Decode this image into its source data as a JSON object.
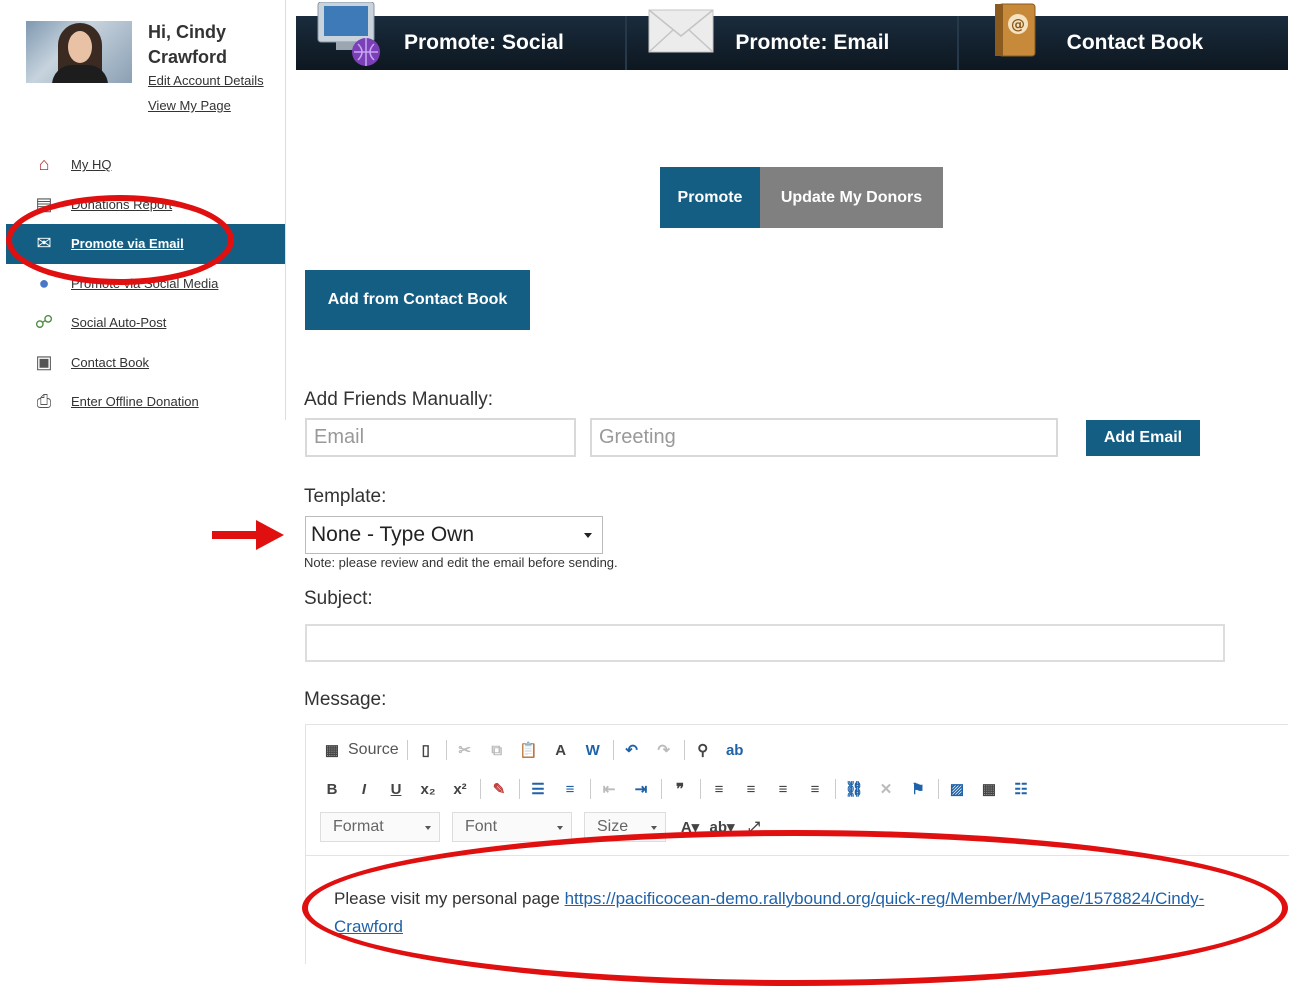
{
  "user": {
    "greeting": "Hi, Cindy Crawford",
    "edit_link": "Edit Account Details",
    "view_link": "View My Page"
  },
  "sidebar": {
    "items": [
      {
        "label": "My HQ",
        "icon": "home-icon"
      },
      {
        "label": "Donations Report",
        "icon": "report-icon"
      },
      {
        "label": "Promote via Email",
        "icon": "envelope-icon",
        "active": true
      },
      {
        "label": "Promote via Social Media",
        "icon": "globe-icon"
      },
      {
        "label": "Social Auto-Post",
        "icon": "share-icon"
      },
      {
        "label": "Contact Book",
        "icon": "address-card-icon"
      },
      {
        "label": "Enter Offline Donation",
        "icon": "printer-icon"
      }
    ]
  },
  "tabs": [
    {
      "label": "Promote: Social",
      "icon": "monitor-globe-icon"
    },
    {
      "label": "Promote: Email",
      "icon": "envelope-icon"
    },
    {
      "label": "Contact Book",
      "icon": "address-book-icon"
    }
  ],
  "segment": {
    "promote": "Promote",
    "update": "Update My Donors"
  },
  "add_contact_label": "Add from Contact Book",
  "add_friends": {
    "heading": "Add Friends Manually:",
    "email_placeholder": "Email",
    "greeting_placeholder": "Greeting",
    "add_button": "Add Email"
  },
  "template": {
    "heading": "Template:",
    "selected": "None - Type Own",
    "note": "Note: please review and edit the email before sending."
  },
  "subject": {
    "heading": "Subject:",
    "value": ""
  },
  "message": {
    "heading": "Message:",
    "toolbar": {
      "source": "Source",
      "format": "Format",
      "font": "Font",
      "size": "Size"
    },
    "body_text": "Please visit my personal page ",
    "link": "https://pacificocean-demo.rallybound.org/quick-reg/Member/MyPage/1578824/Cindy-Crawford"
  },
  "colors": {
    "accent": "#145e83",
    "tabbar": "#0e1822",
    "annotation": "#e01010",
    "secondary_button": "#808080"
  }
}
